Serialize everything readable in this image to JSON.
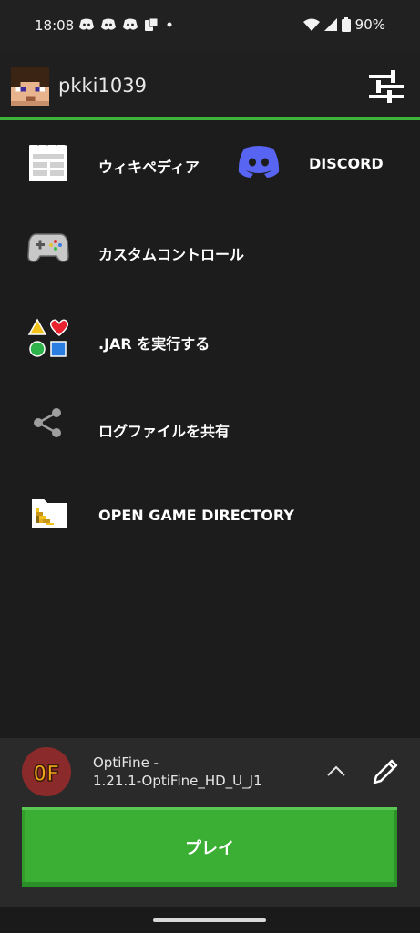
{
  "status_bar": {
    "time": "18:08",
    "battery": "90%",
    "icons": [
      "discord-notification-icon",
      "discord-notification-icon",
      "discord-notification-icon",
      "phone-notification-icon",
      "dot-icon",
      "wifi-icon",
      "signal-icon",
      "battery-icon"
    ]
  },
  "account": {
    "username": "pkki1039",
    "avatar_icon": "minecraft-skin-avatar",
    "settings_icon": "sliders-icon"
  },
  "menu": {
    "wiki_label": "ウィキペディア",
    "discord_label": "DISCORD",
    "custom_controls_label": "カスタムコントロール",
    "run_jar_label": ".JAR を実行する",
    "share_logs_label": "ログファイルを共有",
    "open_dir_label": "OPEN GAME DIRECTORY"
  },
  "profile": {
    "name_line1": "OptiFine -",
    "name_line2": "1.21.1-OptiFine_HD_U_J1",
    "icon_text": "OF",
    "play_label": "プレイ"
  },
  "colors": {
    "accent_green": "#3db33a",
    "discord_blue": "#5865f2",
    "background": "#1c1c1c"
  }
}
